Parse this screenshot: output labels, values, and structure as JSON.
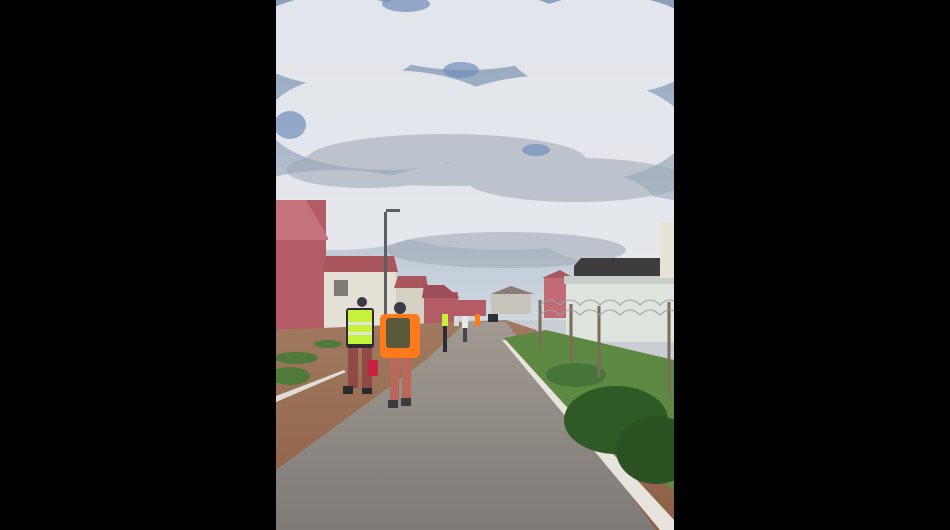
{
  "image": {
    "alt": "",
    "background_color": "#000000",
    "scene": {
      "sky_color": "#9fb0c4",
      "cloud_color": "#e6e8ec",
      "road_color": "#8e8a86",
      "dirt_color": "#9c6e52",
      "grass_color": "#4f7a3a",
      "house_colors": [
        "#b45c66",
        "#c26b74",
        "#e7e2d6",
        "#d5d0c4"
      ],
      "vest_color": "#c6f23a",
      "jacket_color": "#ff7a1a"
    }
  }
}
